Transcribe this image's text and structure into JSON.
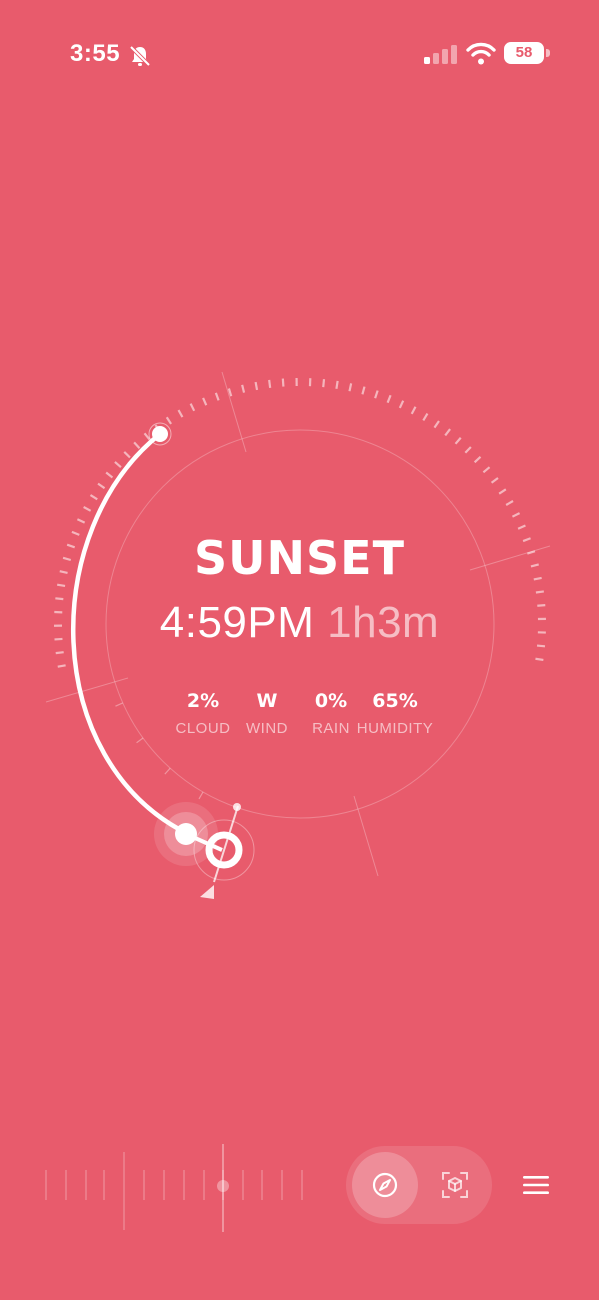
{
  "status_bar": {
    "time": "3:55",
    "battery": "58"
  },
  "event": {
    "title": "SUNSET",
    "time": "4:59PM",
    "remaining": "1h3m"
  },
  "stats": [
    {
      "value": "2%",
      "label": "CLOUD"
    },
    {
      "value": "W",
      "label": "WIND"
    },
    {
      "value": "0%",
      "label": "RAIN"
    },
    {
      "value": "65%",
      "label": "HUMIDITY"
    }
  ],
  "icons": {
    "bell": "bell-slash-icon",
    "signal": "cellular-signal-icon",
    "wifi": "wifi-icon",
    "compass": "compass-icon",
    "ar": "ar-cube-icon",
    "menu": "hamburger-menu-icon"
  },
  "colors": {
    "background": "#e85b6c",
    "foreground": "#ffffff"
  }
}
